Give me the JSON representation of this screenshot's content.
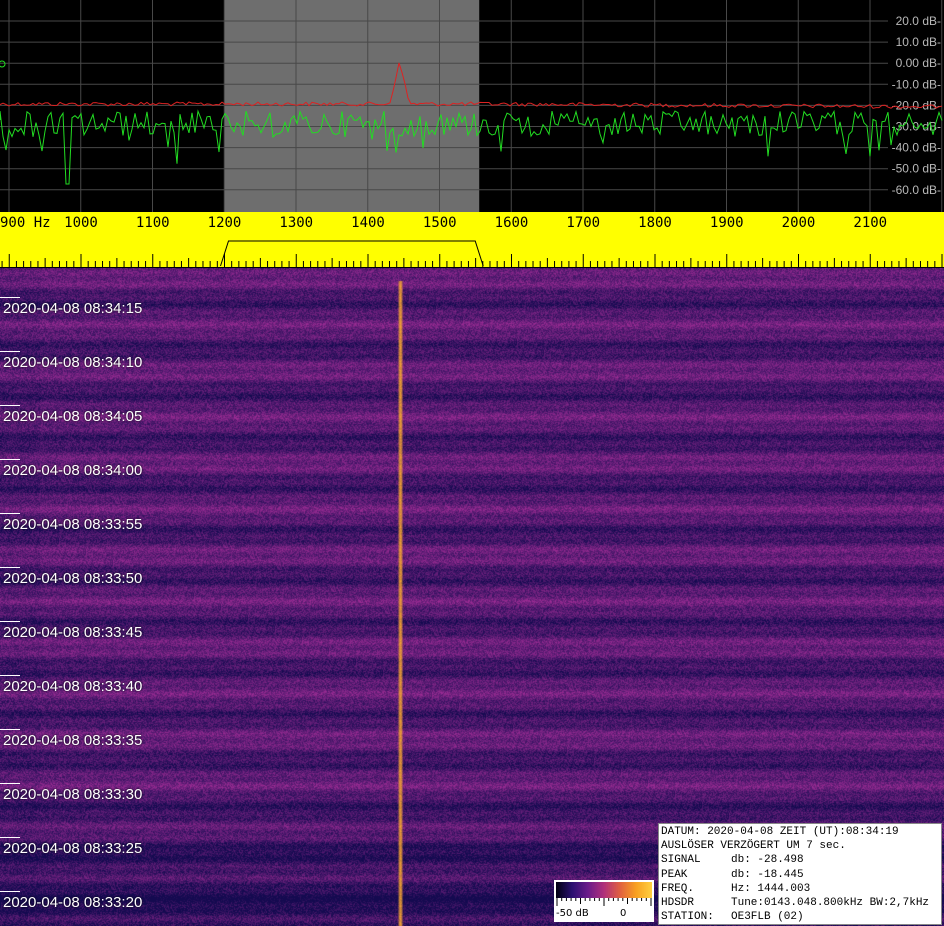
{
  "spectrum": {
    "db_labels": [
      "20.0 dB-",
      "10.0 dB-",
      "0.00 dB-",
      "-10.0 dB-",
      "-20.0 dB-",
      "-30.0 dB-",
      "-40.0 dB-",
      "-50.0 dB-",
      "-60.0 dB-"
    ],
    "passband_hz": [
      1200,
      1555
    ],
    "peak_hz": 1444,
    "colors": {
      "grid": "#3c3c3c",
      "trace": "#22dd22",
      "average": "#dd2222",
      "passband": "#6e6e6e",
      "background": "#000000"
    }
  },
  "ruler": {
    "first_label": "900 Hz",
    "freq_labels": [
      "1000",
      "1100",
      "1200",
      "1300",
      "1400",
      "1500",
      "1600",
      "1700",
      "1800",
      "1900",
      "2000",
      "2100"
    ],
    "colors": {
      "background": "#ffff00",
      "ink": "#000000"
    }
  },
  "waterfall": {
    "timestamps": [
      "2020-04-08 08:34:15",
      "2020-04-08 08:34:10",
      "2020-04-08 08:34:05",
      "2020-04-08 08:34:00",
      "2020-04-08 08:33:55",
      "2020-04-08 08:33:50",
      "2020-04-08 08:33:45",
      "2020-04-08 08:33:40",
      "2020-04-08 08:33:35",
      "2020-04-08 08:33:30",
      "2020-04-08 08:33:25",
      "2020-04-08 08:33:20"
    ],
    "signal_hz": 1444,
    "colors": {
      "low": "#1a1060",
      "mid": "#5a2a8a",
      "signal": "#f0a030"
    }
  },
  "colorbar": {
    "min_label": "-50 dB",
    "max_label": "0"
  },
  "info": {
    "line1": "DATUM: 2020-04-08 ZEIT (UT):08:34:19",
    "line2": "AUSLÖSER VERZÖGERT UM 7 sec.",
    "rows": [
      {
        "key": "SIGNAL",
        "value": "db: -28.498"
      },
      {
        "key": "PEAK",
        "value": "db: -18.445"
      },
      {
        "key": "FREQ.",
        "value": "Hz: 1444.003"
      },
      {
        "key": "HDSDR",
        "value": "Tune:0143.048.800kHz BW:2,7kHz"
      },
      {
        "key": "STATION:",
        "value": "OE3FLB (02)"
      }
    ]
  }
}
